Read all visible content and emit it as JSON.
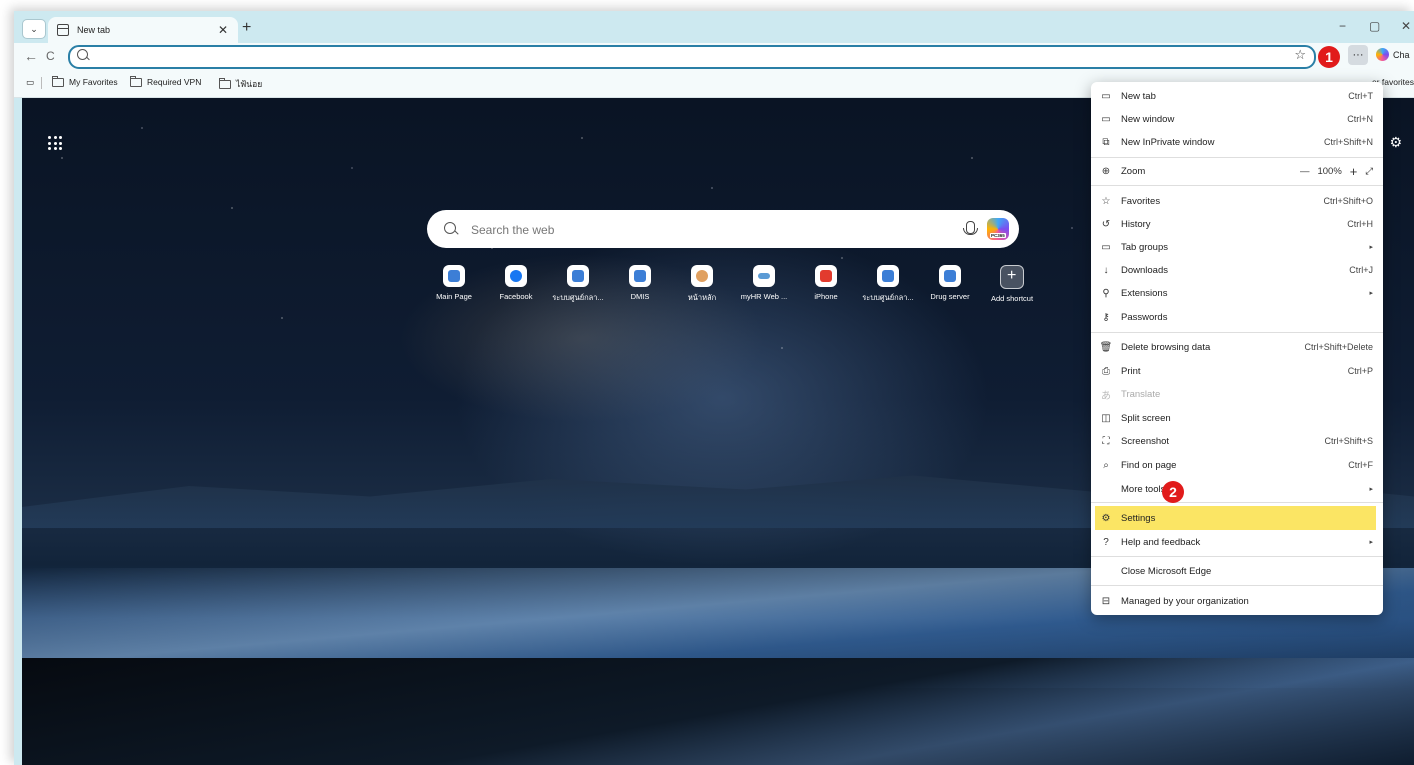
{
  "tab": {
    "title": "New tab",
    "close": "✕"
  },
  "window_controls": {
    "minimize": "−",
    "restore": "▢",
    "close": "✕"
  },
  "toolbar": {
    "back": "←",
    "refresh": "C",
    "menu_label": "···",
    "copilot_label": "Cha"
  },
  "addressbar": {
    "value": "",
    "placeholder": ""
  },
  "bookmarks": {
    "items": [
      "My Favorites",
      "Required VPN",
      "ไฟ้น่อย"
    ],
    "other_favorites": "er favorites"
  },
  "newtab": {
    "search_placeholder": "Search the web",
    "shortcuts": [
      {
        "label": "Main Page",
        "style": "blue"
      },
      {
        "label": "Facebook",
        "style": "fb"
      },
      {
        "label": "ระบบศูนย์กลา...",
        "style": "blue"
      },
      {
        "label": "DMIS",
        "style": "blue"
      },
      {
        "label": "หน้าหลัก",
        "style": "orange"
      },
      {
        "label": "myHR Web ...",
        "style": "hr"
      },
      {
        "label": "iPhone",
        "style": "red"
      },
      {
        "label": "ระบบศูนย์กลา...",
        "style": "blue"
      },
      {
        "label": "Drug server",
        "style": "blue"
      },
      {
        "label": "Add shortcut",
        "style": "add"
      }
    ]
  },
  "menu": {
    "new_tab": {
      "label": "New tab",
      "shortcut": "Ctrl+T"
    },
    "new_window": {
      "label": "New window",
      "shortcut": "Ctrl+N"
    },
    "new_inprivate": {
      "label": "New InPrivate window",
      "shortcut": "Ctrl+Shift+N"
    },
    "zoom": {
      "label": "Zoom",
      "minus": "—",
      "value": "100%",
      "plus": "+",
      "fullscreen": "⤢"
    },
    "favorites": {
      "label": "Favorites",
      "shortcut": "Ctrl+Shift+O"
    },
    "history": {
      "label": "History",
      "shortcut": "Ctrl+H"
    },
    "tab_groups": {
      "label": "Tab groups"
    },
    "downloads": {
      "label": "Downloads",
      "shortcut": "Ctrl+J"
    },
    "extensions": {
      "label": "Extensions"
    },
    "passwords": {
      "label": "Passwords"
    },
    "delete_browsing": {
      "label": "Delete browsing data",
      "shortcut": "Ctrl+Shift+Delete"
    },
    "print": {
      "label": "Print",
      "shortcut": "Ctrl+P"
    },
    "translate": {
      "label": "Translate"
    },
    "split_screen": {
      "label": "Split screen"
    },
    "screenshot": {
      "label": "Screenshot",
      "shortcut": "Ctrl+Shift+S"
    },
    "find_on_page": {
      "label": "Find on page",
      "shortcut": "Ctrl+F"
    },
    "more_tools": {
      "label": "More tools"
    },
    "settings": {
      "label": "Settings"
    },
    "help": {
      "label": "Help and feedback"
    },
    "close_edge": {
      "label": "Close Microsoft Edge"
    },
    "managed": {
      "label": "Managed by your organization"
    }
  },
  "callouts": {
    "one": "1",
    "two": "2"
  },
  "colors": {
    "highlight": "#fbe564",
    "badge": "#e11b1b",
    "frame": "#cde9f0",
    "address_border": "#2a7fa6"
  }
}
